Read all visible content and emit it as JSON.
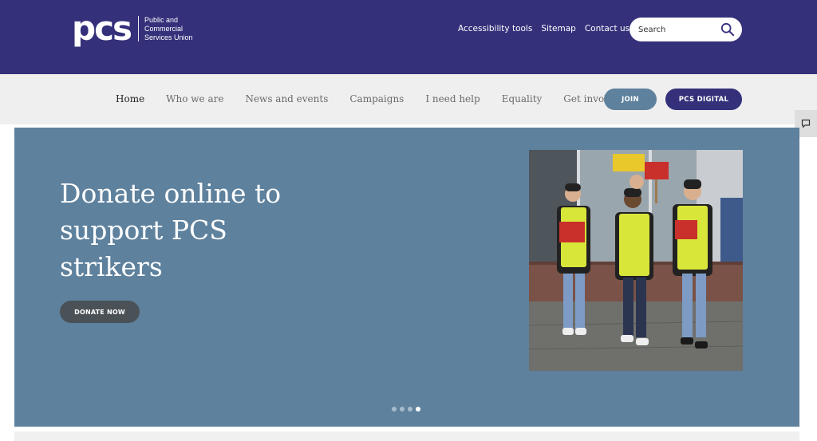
{
  "header": {
    "logo": {
      "mark": "pcs",
      "lines": [
        "Public and",
        "Commercial",
        "Services Union"
      ]
    },
    "util_links": [
      "Accessibility tools",
      "Sitemap",
      "Contact us"
    ],
    "search": {
      "placeholder": "Search",
      "icon": "search-icon"
    }
  },
  "nav": {
    "items": [
      "Home",
      "Who we are",
      "News and events",
      "Campaigns",
      "I need help",
      "Equality",
      "Get involved"
    ],
    "active": "Home",
    "join_label": "JOIN",
    "digital_label": "PCS DIGITAL"
  },
  "feedback": {
    "icon": "chat-icon"
  },
  "hero": {
    "title": "Donate online to support PCS strikers",
    "button_label": "DONATE NOW",
    "slides": 4,
    "active_slide": 4
  },
  "colors": {
    "brand_purple": "#34307a",
    "hero_blue": "#5e819d",
    "nav_bg": "#efefef",
    "donate_button": "#4a5258"
  }
}
